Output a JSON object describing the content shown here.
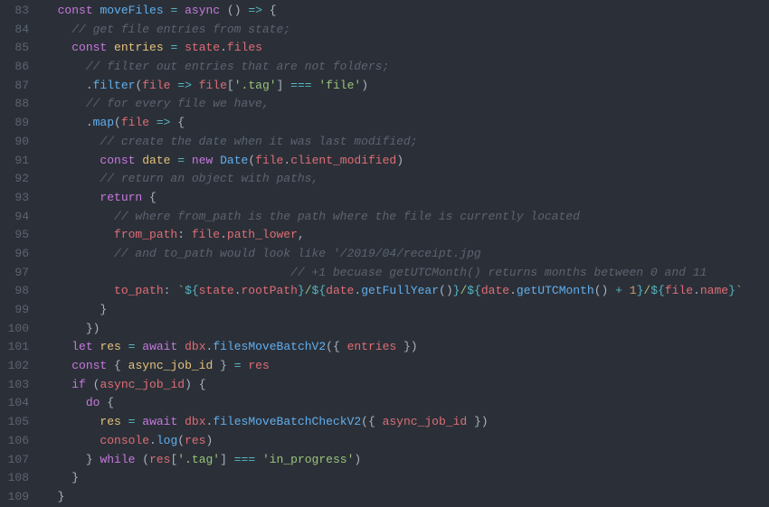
{
  "startLine": 83,
  "lines": [
    {
      "n": 83,
      "html": "  <span class='kw'>const</span> <span class='fn'>moveFiles</span> <span class='op'>=</span> <span class='kw'>async</span> <span class='pn'>()</span> <span class='op'>=&gt;</span> <span class='pn'>{</span>"
    },
    {
      "n": 84,
      "html": "    <span class='cm'>// get file entries from state;</span>"
    },
    {
      "n": 85,
      "html": "    <span class='kw'>const</span> <span class='vr'>entries</span> <span class='op'>=</span> <span class='pr'>state</span><span class='pn'>.</span><span class='pr'>files</span>"
    },
    {
      "n": 86,
      "html": "      <span class='cm'>// filter out entries that are not folders;</span>"
    },
    {
      "n": 87,
      "html": "      <span class='pn'>.</span><span class='fn'>filter</span><span class='pn'>(</span><span class='pr'>file</span> <span class='op'>=&gt;</span> <span class='pr'>file</span><span class='pn'>[</span><span class='str'>'.tag'</span><span class='pn'>]</span> <span class='op'>===</span> <span class='str'>'file'</span><span class='pn'>)</span>"
    },
    {
      "n": 88,
      "html": "      <span class='cm'>// for every file we have,</span>"
    },
    {
      "n": 89,
      "html": "      <span class='pn'>.</span><span class='fn'>map</span><span class='pn'>(</span><span class='pr'>file</span> <span class='op'>=&gt;</span> <span class='pn'>{</span>"
    },
    {
      "n": 90,
      "html": "        <span class='cm'>// create the date when it was last modified;</span>"
    },
    {
      "n": 91,
      "html": "        <span class='kw'>const</span> <span class='vr'>date</span> <span class='op'>=</span> <span class='kw'>new</span> <span class='fn'>Date</span><span class='pn'>(</span><span class='pr'>file</span><span class='pn'>.</span><span class='pr'>client_modified</span><span class='pn'>)</span>"
    },
    {
      "n": 92,
      "html": "        <span class='cm'>// return an object with paths,</span>"
    },
    {
      "n": 93,
      "html": "        <span class='kw'>return</span> <span class='pn'>{</span>"
    },
    {
      "n": 94,
      "html": "          <span class='cm'>// where from_path is the path where the file is currently located</span>"
    },
    {
      "n": 95,
      "html": "          <span class='pr'>from_path</span><span class='pn'>:</span> <span class='pr'>file</span><span class='pn'>.</span><span class='pr'>path_lower</span><span class='pn'>,</span>"
    },
    {
      "n": 96,
      "html": "          <span class='cm'>// and to_path would look like '/2019/04/receipt.jpg</span>"
    },
    {
      "n": 97,
      "html": "                                   <span class='cm'>// +1 becuase getUTCMonth() returns months between 0 and 11</span>"
    },
    {
      "n": 98,
      "html": "          <span class='pr'>to_path</span><span class='pn'>:</span> <span class='tpl'>`</span><span class='op'>${</span><span class='pr'>state</span><span class='pn'>.</span><span class='pr'>rootPath</span><span class='op'>}</span><span class='tpl'>/</span><span class='op'>${</span><span class='pr'>date</span><span class='pn'>.</span><span class='fn'>getFullYear</span><span class='pn'>()</span><span class='op'>}</span><span class='tpl'>/</span><span class='op'>${</span><span class='pr'>date</span><span class='pn'>.</span><span class='fn'>getUTCMonth</span><span class='pn'>()</span> <span class='op'>+</span> <span class='nm'>1</span><span class='op'>}</span><span class='tpl'>/</span><span class='op'>${</span><span class='pr'>file</span><span class='pn'>.</span><span class='pr'>name</span><span class='op'>}</span><span class='tpl'>`</span>"
    },
    {
      "n": 99,
      "html": "        <span class='pn'>}</span>"
    },
    {
      "n": 100,
      "html": "      <span class='pn'>})</span>"
    },
    {
      "n": 101,
      "html": "    <span class='kw'>let</span> <span class='vr'>res</span> <span class='op'>=</span> <span class='kw'>await</span> <span class='pr'>dbx</span><span class='pn'>.</span><span class='fn'>filesMoveBatchV2</span><span class='pn'>({</span> <span class='pr'>entries</span> <span class='pn'>})</span>"
    },
    {
      "n": 102,
      "html": "    <span class='kw'>const</span> <span class='pn'>{</span> <span class='vr'>async_job_id</span> <span class='pn'>}</span> <span class='op'>=</span> <span class='pr'>res</span>"
    },
    {
      "n": 103,
      "html": "    <span class='kw'>if</span> <span class='pn'>(</span><span class='pr'>async_job_id</span><span class='pn'>)</span> <span class='pn'>{</span>"
    },
    {
      "n": 104,
      "html": "      <span class='kw'>do</span> <span class='pn'>{</span>"
    },
    {
      "n": 105,
      "html": "        <span class='vr'>res</span> <span class='op'>=</span> <span class='kw'>await</span> <span class='pr'>dbx</span><span class='pn'>.</span><span class='fn'>filesMoveBatchCheckV2</span><span class='pn'>({</span> <span class='pr'>async_job_id</span> <span class='pn'>})</span>"
    },
    {
      "n": 106,
      "html": "        <span class='pr'>console</span><span class='pn'>.</span><span class='fn'>log</span><span class='pn'>(</span><span class='pr'>res</span><span class='pn'>)</span>"
    },
    {
      "n": 107,
      "html": "      <span class='pn'>}</span> <span class='kw'>while</span> <span class='pn'>(</span><span class='pr'>res</span><span class='pn'>[</span><span class='str'>'.tag'</span><span class='pn'>]</span> <span class='op'>===</span> <span class='str'>'in_progress'</span><span class='pn'>)</span>"
    },
    {
      "n": 108,
      "html": "    <span class='pn'>}</span>"
    },
    {
      "n": 109,
      "html": "  <span class='pn'>}</span>"
    }
  ]
}
